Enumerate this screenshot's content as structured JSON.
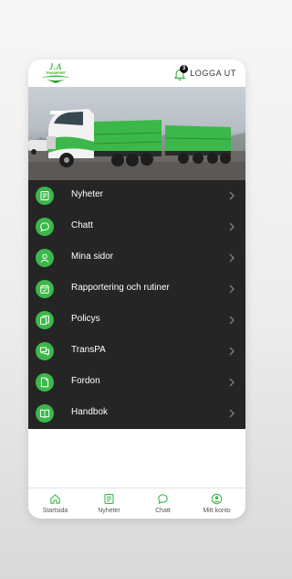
{
  "header": {
    "logo_text": "J.A",
    "logo_subtext": "TRANSPORT",
    "notification_count": "3",
    "logout_label": "LOGGA UT"
  },
  "menu": {
    "items": [
      {
        "label": "Nyheter",
        "icon": "newspaper-icon"
      },
      {
        "label": "Chatt",
        "icon": "chat-icon"
      },
      {
        "label": "Mina sidor",
        "icon": "user-icon"
      },
      {
        "label": "Rapportering och rutiner",
        "icon": "calendar-check-icon"
      },
      {
        "label": "Policys",
        "icon": "documents-icon"
      },
      {
        "label": "TransPA",
        "icon": "chat-bubbles-icon"
      },
      {
        "label": "Fordon",
        "icon": "document-icon"
      },
      {
        "label": "Handbok",
        "icon": "book-icon"
      }
    ]
  },
  "bottom_nav": {
    "items": [
      {
        "label": "Startsida",
        "icon": "home-icon"
      },
      {
        "label": "Nyheter",
        "icon": "newspaper-icon"
      },
      {
        "label": "Chatt",
        "icon": "chat-icon"
      },
      {
        "label": "Mitt konto",
        "icon": "account-icon"
      }
    ]
  },
  "colors": {
    "accent": "#3cb84a",
    "menu_background": "#252526",
    "menu_text": "#ffffff"
  }
}
